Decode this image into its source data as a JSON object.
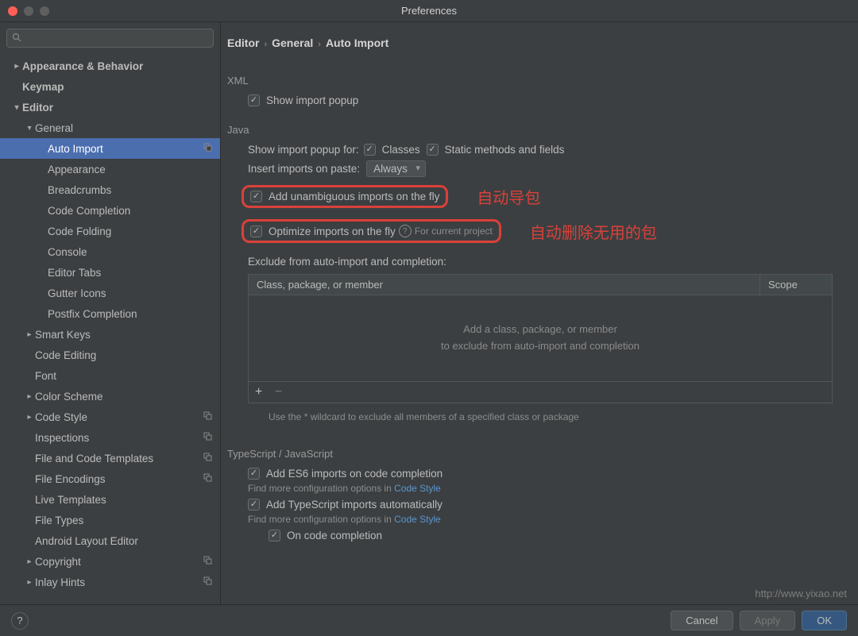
{
  "window": {
    "title": "Preferences"
  },
  "breadcrumb": {
    "editor": "Editor",
    "general": "General",
    "auto_import": "Auto Import"
  },
  "sidebar": {
    "items": [
      {
        "name": "appearance-behavior",
        "label": "Appearance & Behavior",
        "indent": 0,
        "expandable": true,
        "expanded": false,
        "bold": true
      },
      {
        "name": "keymap",
        "label": "Keymap",
        "indent": 0,
        "bold": true
      },
      {
        "name": "editor",
        "label": "Editor",
        "indent": 0,
        "expandable": true,
        "expanded": true,
        "bold": true
      },
      {
        "name": "general",
        "label": "General",
        "indent": 1,
        "expandable": true,
        "expanded": true
      },
      {
        "name": "auto-import",
        "label": "Auto Import",
        "indent": 2,
        "selected": true,
        "shared": true
      },
      {
        "name": "appearance",
        "label": "Appearance",
        "indent": 2
      },
      {
        "name": "breadcrumbs",
        "label": "Breadcrumbs",
        "indent": 2
      },
      {
        "name": "code-completion",
        "label": "Code Completion",
        "indent": 2
      },
      {
        "name": "code-folding",
        "label": "Code Folding",
        "indent": 2
      },
      {
        "name": "console",
        "label": "Console",
        "indent": 2
      },
      {
        "name": "editor-tabs",
        "label": "Editor Tabs",
        "indent": 2
      },
      {
        "name": "gutter-icons",
        "label": "Gutter Icons",
        "indent": 2
      },
      {
        "name": "postfix-completion",
        "label": "Postfix Completion",
        "indent": 2
      },
      {
        "name": "smart-keys",
        "label": "Smart Keys",
        "indent": 1,
        "expandable": true,
        "expanded": false
      },
      {
        "name": "code-editing",
        "label": "Code Editing",
        "indent": 1
      },
      {
        "name": "font",
        "label": "Font",
        "indent": 1
      },
      {
        "name": "color-scheme",
        "label": "Color Scheme",
        "indent": 1,
        "expandable": true,
        "expanded": false
      },
      {
        "name": "code-style",
        "label": "Code Style",
        "indent": 1,
        "expandable": true,
        "expanded": false,
        "shared": true
      },
      {
        "name": "inspections",
        "label": "Inspections",
        "indent": 1,
        "shared": true
      },
      {
        "name": "file-code-templates",
        "label": "File and Code Templates",
        "indent": 1,
        "shared": true
      },
      {
        "name": "file-encodings",
        "label": "File Encodings",
        "indent": 1,
        "shared": true
      },
      {
        "name": "live-templates",
        "label": "Live Templates",
        "indent": 1
      },
      {
        "name": "file-types",
        "label": "File Types",
        "indent": 1
      },
      {
        "name": "android-layout-editor",
        "label": "Android Layout Editor",
        "indent": 1
      },
      {
        "name": "copyright",
        "label": "Copyright",
        "indent": 1,
        "expandable": true,
        "expanded": false,
        "shared": true
      },
      {
        "name": "inlay-hints",
        "label": "Inlay Hints",
        "indent": 1,
        "expandable": true,
        "expanded": false,
        "shared": true
      }
    ]
  },
  "xml": {
    "section": "XML",
    "show_import_popup": "Show import popup"
  },
  "java": {
    "section": "Java",
    "show_popup_for": "Show import popup for:",
    "classes": "Classes",
    "static_methods": "Static methods and fields",
    "insert_on_paste": "Insert imports on paste:",
    "paste_value": "Always",
    "add_unambiguous": "Add unambiguous imports on the fly",
    "optimize": "Optimize imports on the fly",
    "for_current_project": "For current project",
    "exclude_label": "Exclude from auto-import and completion:",
    "col_class": "Class, package, or member",
    "col_scope": "Scope",
    "empty1": "Add a class, package, or member",
    "empty2": "to exclude from auto-import and completion",
    "wildcard_hint": "Use the * wildcard to exclude all members of a specified class or package"
  },
  "annotations": {
    "auto_import": "自动导包",
    "auto_remove": "自动删除无用的包"
  },
  "ts": {
    "section": "TypeScript / JavaScript",
    "add_es6": "Add ES6 imports on code completion",
    "hint1": "Find more configuration options in ",
    "code_style_link": "Code Style",
    "add_ts": "Add TypeScript imports automatically",
    "on_completion": "On code completion"
  },
  "footer": {
    "cancel": "Cancel",
    "apply": "Apply",
    "ok": "OK"
  },
  "watermark": "http://www.yixao.net"
}
